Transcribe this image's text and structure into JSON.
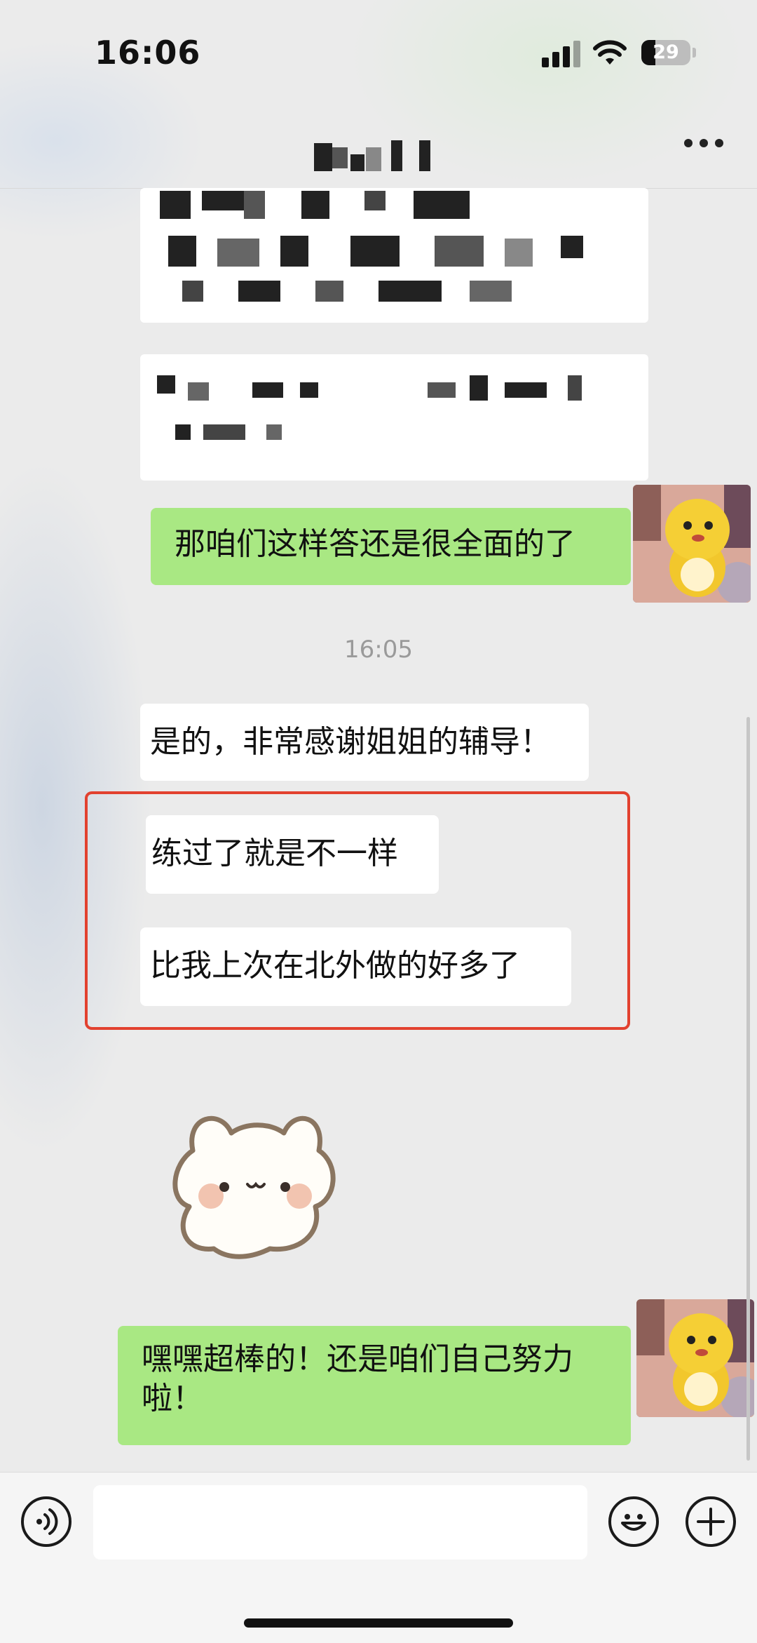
{
  "status_bar": {
    "time": "16:06",
    "battery": "29"
  },
  "chat": {
    "messages": [
      {
        "side": "right",
        "type": "text",
        "text": "那咱们这样答还是很全面的了"
      },
      {
        "type": "timestamp",
        "text": "16:05"
      },
      {
        "side": "left",
        "type": "text",
        "text": "是的，非常感谢姐姐的辅导！"
      },
      {
        "side": "left",
        "type": "text",
        "text": "练过了就是不一样"
      },
      {
        "side": "left",
        "type": "text",
        "text": "比我上次在北外做的好多了"
      },
      {
        "side": "left",
        "type": "sticker",
        "icon": "bunny-sticker-icon"
      },
      {
        "side": "right",
        "type": "text",
        "text": "嘿嘿超棒的！还是咱们自己努力啦！"
      }
    ]
  },
  "colors": {
    "green_bubble": "#a9e883",
    "highlight_border": "#e2412f"
  },
  "input_bar": {
    "voice_icon": "voice-icon",
    "emoji_icon": "emoji-icon",
    "plus_icon": "plus-icon"
  }
}
